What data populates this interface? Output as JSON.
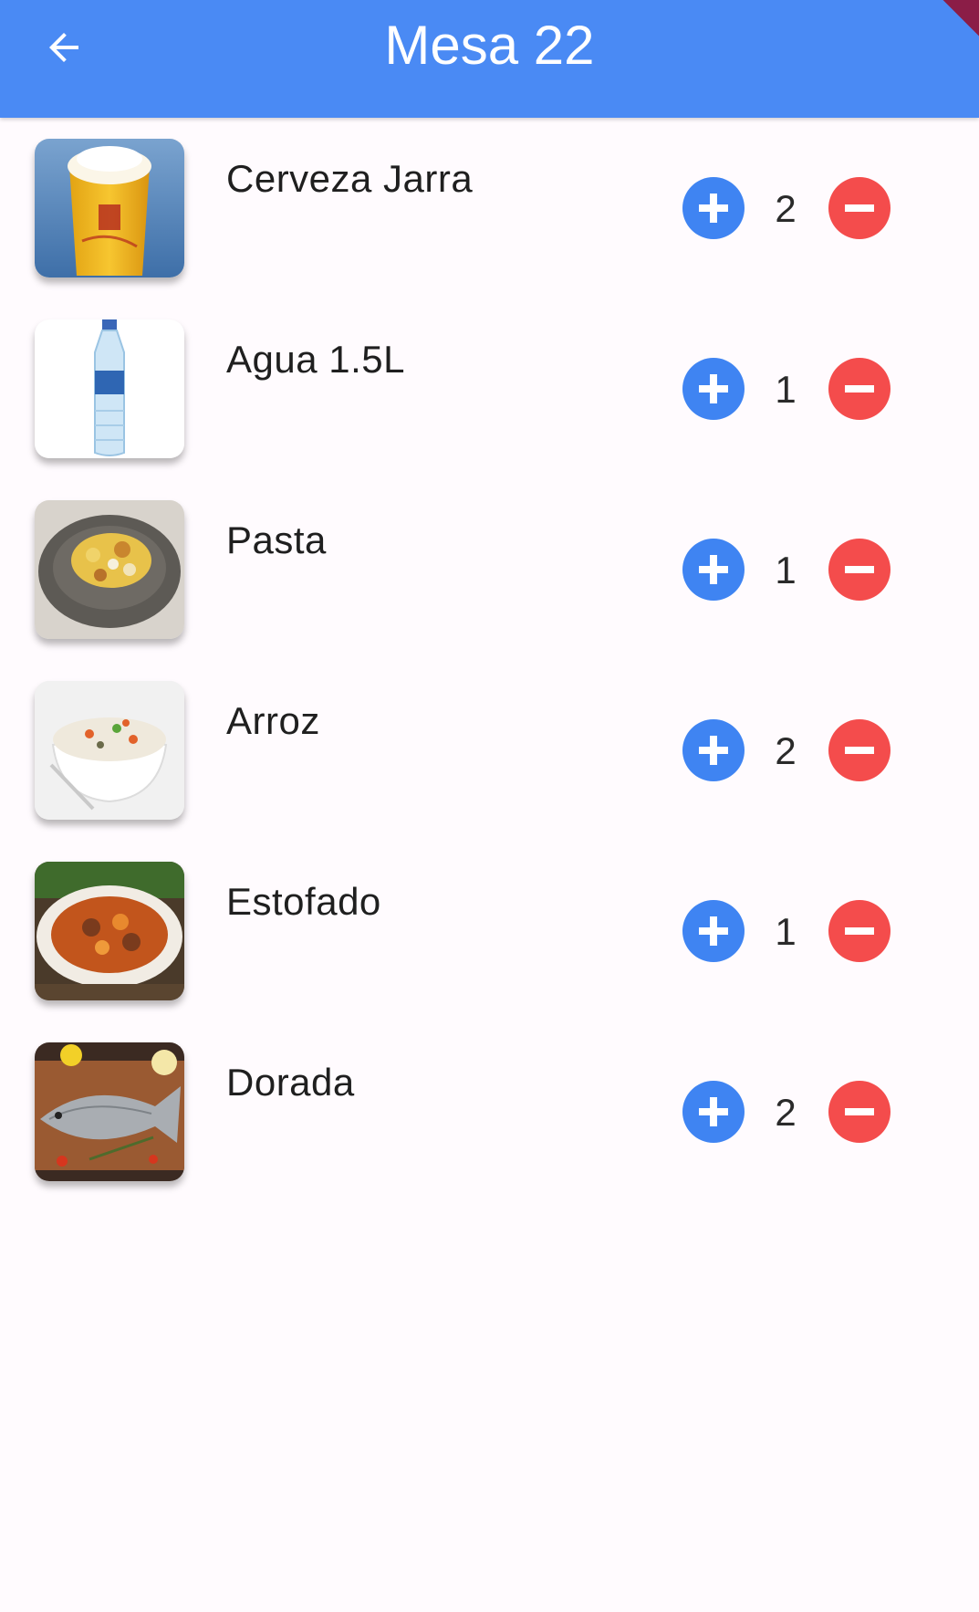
{
  "header": {
    "title": "Mesa 22",
    "background_color": "#4a8af4"
  },
  "items": [
    {
      "name": "Cerveza Jarra",
      "quantity": "2",
      "image": "beer-mug-image"
    },
    {
      "name": "Agua 1.5L",
      "quantity": "1",
      "image": "water-bottle-image"
    },
    {
      "name": "Pasta",
      "quantity": "1",
      "image": "pasta-plate-image"
    },
    {
      "name": "Arroz",
      "quantity": "2",
      "image": "rice-bowl-image"
    },
    {
      "name": "Estofado",
      "quantity": "1",
      "image": "stew-plate-image"
    },
    {
      "name": "Dorada",
      "quantity": "2",
      "image": "sea-bream-fish-image"
    }
  ],
  "colors": {
    "plus_button": "#3f84f2",
    "minus_button": "#f44c4c",
    "background": "#fffbfe"
  },
  "icons": {
    "back": "arrow-back-icon",
    "plus": "add-circle-icon",
    "minus": "remove-circle-icon"
  }
}
